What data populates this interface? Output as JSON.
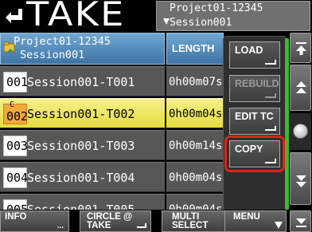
{
  "header": {
    "title": "TAKE",
    "current_project_line1": "Project01-12345",
    "current_project_line2": "Session001"
  },
  "list": {
    "header_name_line1": "Project01-12345",
    "header_name_line2": "Session001",
    "header_length": "LENGTH",
    "rows": [
      {
        "number": "001",
        "name": "Session001-T001",
        "length": "0h00m07s",
        "selected": false
      },
      {
        "number": "002",
        "name": "Session001-T002",
        "length": "0h00m04s",
        "selected": true,
        "mark": "C"
      },
      {
        "number": "003",
        "name": "Session001-T003",
        "length": "0h00m14s",
        "selected": false
      },
      {
        "number": "004",
        "name": "Session001-T004",
        "length": "0h00m04s",
        "selected": false
      },
      {
        "number": "005",
        "name": "Session001-T005",
        "length": "0h00m04s",
        "selected": false
      }
    ]
  },
  "popup_menu": {
    "items": [
      {
        "label": "LOAD",
        "enabled": true
      },
      {
        "label": "REBUILD",
        "enabled": false
      },
      {
        "label": "EDIT TC",
        "enabled": true
      },
      {
        "label": "COPY",
        "enabled": true,
        "highlighted": true
      }
    ]
  },
  "bottom_bar": {
    "info_label": "INFO",
    "info_dots": "...",
    "circle_take_line1": "CIRCLE @",
    "circle_take_line2": "TAKE",
    "multi_select_line1": "MULTI",
    "multi_select_line2": "SELECT",
    "menu_label": "MENU"
  },
  "colors": {
    "selected_row": "#eee366",
    "header_blue": "#4f86b8",
    "highlight_box": "#e0201c",
    "scroll_green": "#3dbb2e"
  }
}
